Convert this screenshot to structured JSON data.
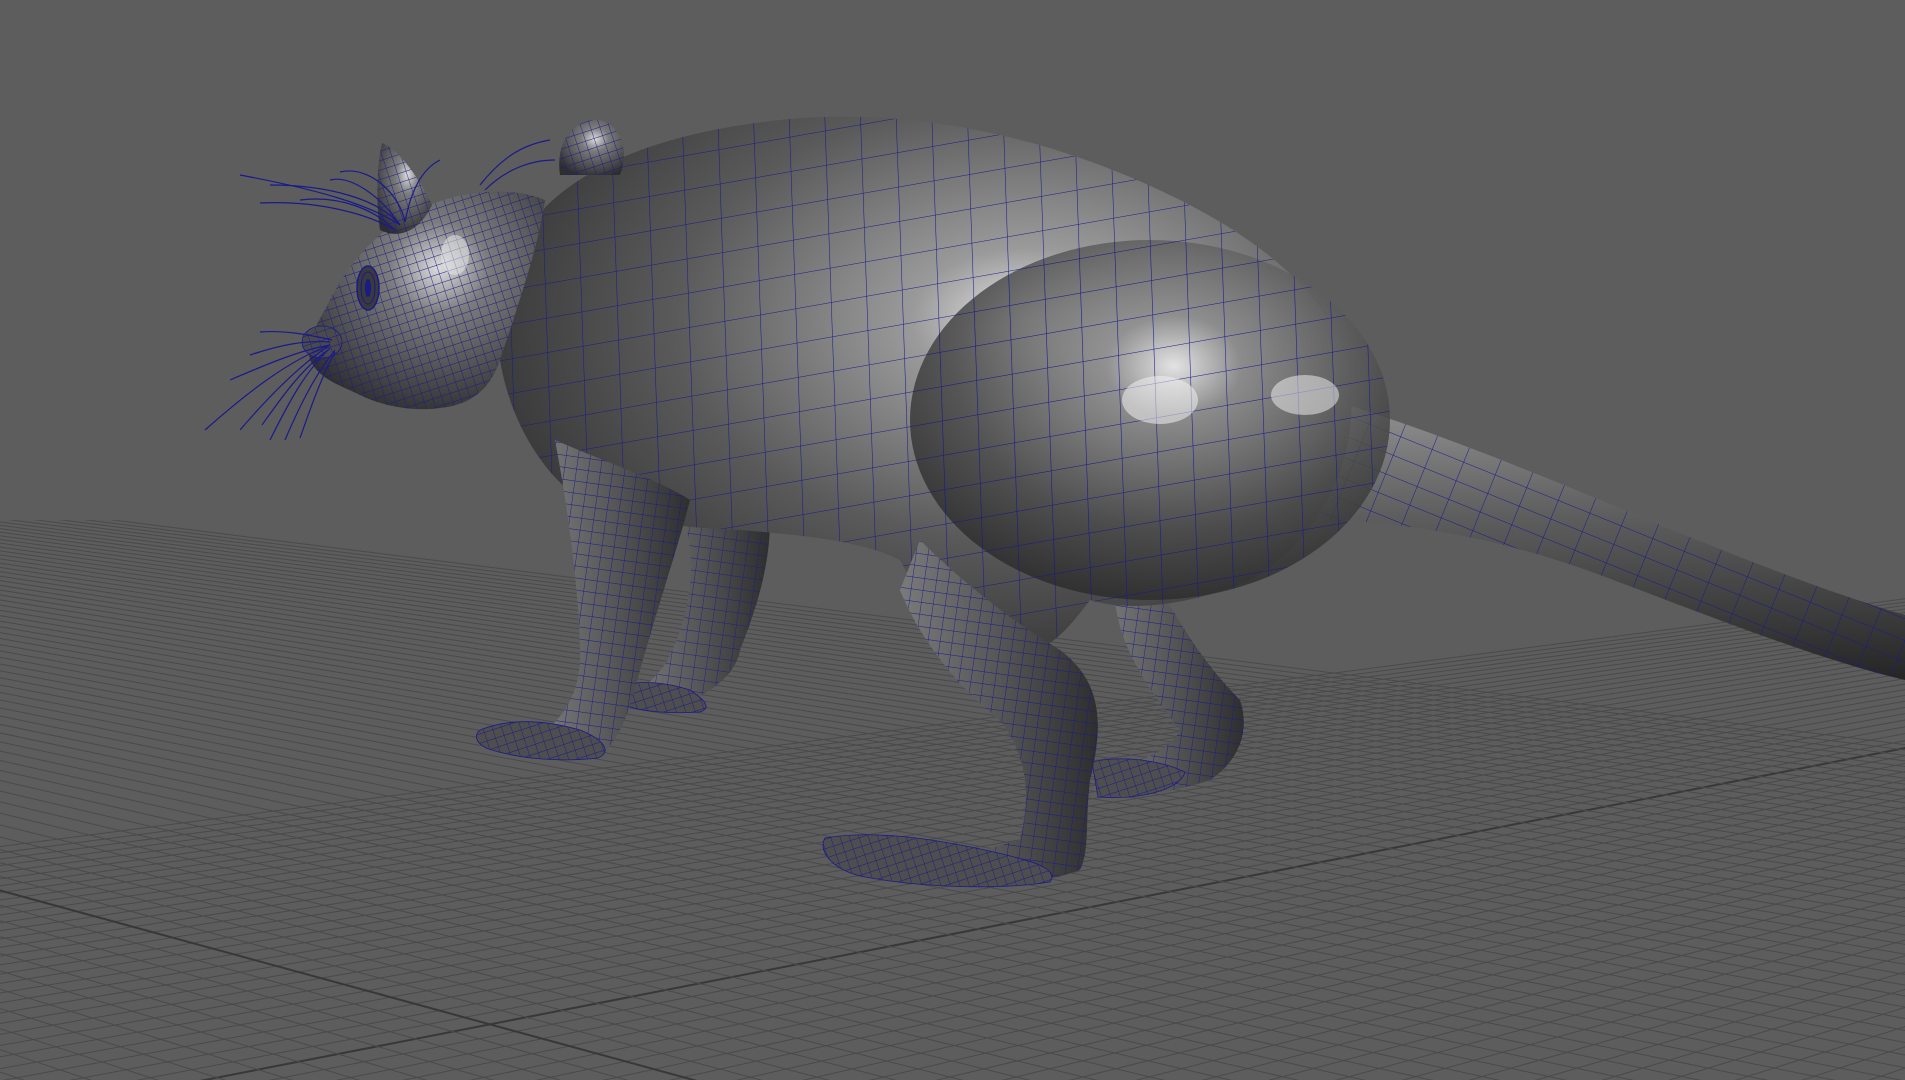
{
  "viewport": {
    "panel": "3d-perspective-viewport",
    "shading_mode": "smooth-shade-with-wireframe-on-shaded",
    "selection_state": "selected",
    "ground_grid": "visible"
  },
  "colors": {
    "background": "#5d5d5d",
    "grid_line": "#4a4a4a",
    "grid_axis": "#383838",
    "wireframe": "#1a1a8c",
    "shaded_dark": "#2b2b2b",
    "shaded_mid": "#6e6e6e",
    "shaded_light": "#d8d8d8"
  },
  "model": {
    "subject": "rat",
    "parts": [
      "head",
      "ears",
      "eyes",
      "whiskers",
      "body",
      "tail",
      "front-legs",
      "hind-legs",
      "feet"
    ]
  }
}
